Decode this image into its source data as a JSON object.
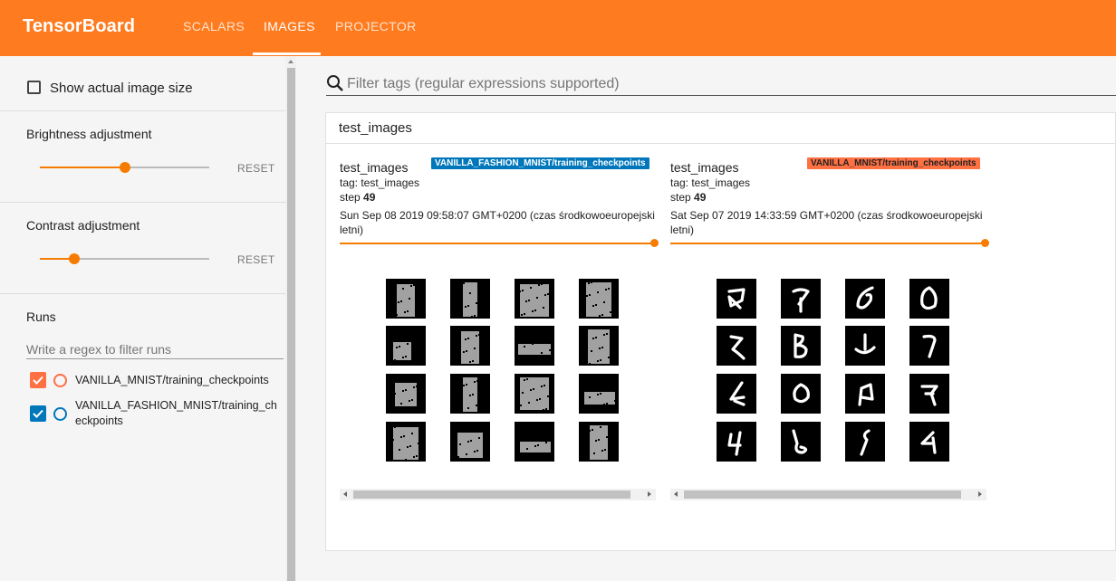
{
  "app": {
    "title": "TensorBoard"
  },
  "tabs": [
    {
      "label": "SCALARS",
      "active": false
    },
    {
      "label": "IMAGES",
      "active": true
    },
    {
      "label": "PROJECTOR",
      "active": false
    }
  ],
  "sidebar": {
    "show_actual_size": {
      "label": "Show actual image size",
      "checked": false
    },
    "brightness": {
      "label": "Brightness adjustment",
      "value": 0.5,
      "reset_label": "RESET"
    },
    "contrast": {
      "label": "Contrast adjustment",
      "value": 0.2,
      "reset_label": "RESET"
    },
    "runs": {
      "title": "Runs",
      "filter_placeholder": "Write a regex to filter runs",
      "items": [
        {
          "name": "VANILLA_MNIST/training_checkpoints",
          "checked": true,
          "color": "#ff7043"
        },
        {
          "name_line1": "VANILLA_FASHION_MNIST/training_ch",
          "name_line2": "eckpoints",
          "checked": true,
          "color": "#0077bb"
        }
      ]
    }
  },
  "main": {
    "search_placeholder": "Filter tags (regular expressions supported)",
    "card_title": "test_images",
    "panels": [
      {
        "title": "test_images",
        "run": "VANILLA_FASHION_MNIST/training_checkpoints",
        "run_color": "#0077bb",
        "tag_line": "tag: test_images",
        "step_label": "step",
        "step": "49",
        "timestamp_line1": "Sun Sep 08 2019 09:58:07 GMT+0200 (czas środkowoeuropejski",
        "timestamp_line2": "letni)",
        "step_position": 1.0
      },
      {
        "title": "test_images",
        "run": "VANILLA_MNIST/training_checkpoints",
        "run_color": "#ff7043",
        "tag_line": "tag: test_images",
        "step_label": "step",
        "step": "49",
        "timestamp_line1": "Sat Sep 07 2019 14:33:59 GMT+0200 (czas środkowoeuropejski",
        "timestamp_line2": "letni)",
        "step_position": 1.0
      }
    ]
  },
  "colors": {
    "accent": "#ff7b1f",
    "header_bg": "#ff7b1f"
  }
}
